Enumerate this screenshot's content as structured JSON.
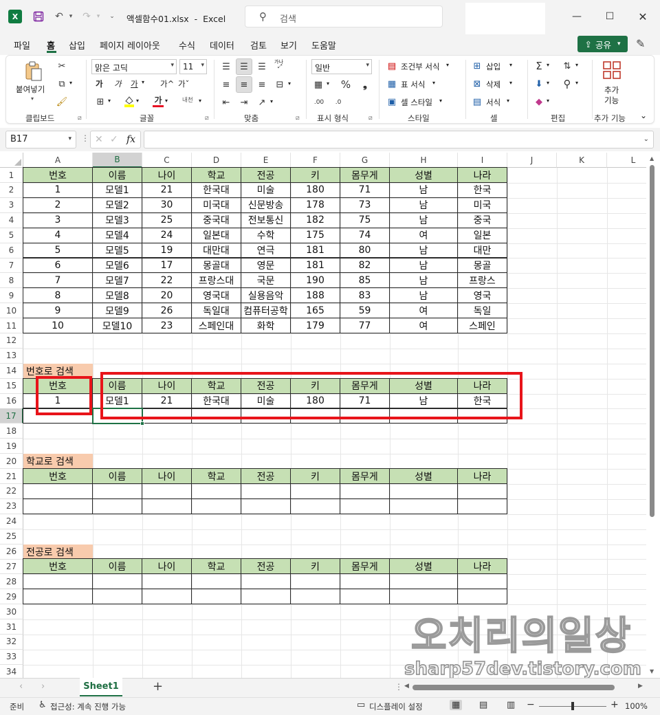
{
  "titlebar": {
    "file_name": "액셀함수01.xlsx",
    "separator": "-",
    "app_name": "Excel",
    "search_placeholder": "검색"
  },
  "menu": {
    "tabs": [
      "파일",
      "홈",
      "삽입",
      "페이지 레이아웃",
      "수식",
      "데이터",
      "검토",
      "보기",
      "도움말"
    ],
    "active": "홈",
    "share_label": "공유"
  },
  "ribbon": {
    "clipboard": {
      "paste": "붙여넣기",
      "group": "클립보드"
    },
    "font": {
      "font_name": "맑은 고딕",
      "font_size": "11",
      "bold": "가",
      "italic": "가",
      "underline": "가",
      "grow": "가^",
      "shrink": "가ˇ",
      "font_color_glyph": "가",
      "phonetic": "내천",
      "group": "글꼴",
      "fill_color": "#ffff00",
      "font_color": "#e81123"
    },
    "align": {
      "wrap": "가나",
      "group": "맞춤"
    },
    "number": {
      "format": "일반",
      "group": "표시 형식"
    },
    "styles": {
      "conditional": "조건부 서식",
      "table": "표 서식",
      "cell_style": "셀 스타일",
      "group": "스타일"
    },
    "cells": {
      "insert": "삽입",
      "delete": "삭제",
      "format": "서식",
      "group": "셀"
    },
    "editing": {
      "group": "편집"
    },
    "addins": {
      "label_line1": "추가",
      "label_line2": "기능",
      "group": "추가 기능"
    }
  },
  "formula_bar": {
    "name_box": "B17",
    "fx": "fx",
    "formula": ""
  },
  "grid": {
    "columns": [
      "A",
      "B",
      "C",
      "D",
      "E",
      "F",
      "G",
      "H",
      "I",
      "J",
      "K",
      "L"
    ],
    "selected_column": "B",
    "rows": [
      1,
      2,
      3,
      4,
      5,
      6,
      7,
      8,
      9,
      10,
      11,
      12,
      13,
      14,
      15,
      16,
      17,
      18,
      19,
      20,
      21,
      22,
      23,
      24,
      25,
      26,
      27,
      28,
      29,
      30,
      31,
      32,
      33,
      34
    ],
    "selected_row": 17,
    "header_row": [
      "번호",
      "이름",
      "나이",
      "학교",
      "전공",
      "키",
      "몸무게",
      "성별",
      "나라"
    ],
    "data": [
      [
        "1",
        "모델1",
        "21",
        "한국대",
        "미술",
        "180",
        "71",
        "남",
        "한국"
      ],
      [
        "2",
        "모델2",
        "30",
        "미국대",
        "신문방송",
        "178",
        "73",
        "남",
        "미국"
      ],
      [
        "3",
        "모델3",
        "25",
        "중국대",
        "전보통신",
        "182",
        "75",
        "남",
        "중국"
      ],
      [
        "4",
        "모델4",
        "24",
        "일본대",
        "수학",
        "175",
        "74",
        "여",
        "일본"
      ],
      [
        "5",
        "모델5",
        "19",
        "대만대",
        "연극",
        "181",
        "80",
        "남",
        "대만"
      ],
      [
        "6",
        "모델6",
        "17",
        "몽골대",
        "영문",
        "181",
        "82",
        "남",
        "몽골"
      ],
      [
        "7",
        "모델7",
        "22",
        "프랑스대",
        "국문",
        "190",
        "85",
        "남",
        "프랑스"
      ],
      [
        "8",
        "모델8",
        "20",
        "영국대",
        "실용음악",
        "188",
        "83",
        "남",
        "영국"
      ],
      [
        "9",
        "모델9",
        "26",
        "독일대",
        "컴퓨터공학",
        "165",
        "59",
        "여",
        "독일"
      ],
      [
        "10",
        "모델10",
        "23",
        "스페인대",
        "화학",
        "179",
        "77",
        "여",
        "스페인"
      ]
    ],
    "search1": {
      "label": "번호로 검색",
      "result": [
        "1",
        "모델1",
        "21",
        "한국대",
        "미술",
        "180",
        "71",
        "남",
        "한국"
      ]
    },
    "search2": {
      "label": "학교로 검색"
    },
    "search3": {
      "label": "전공로 검색"
    },
    "header_color": "#c6e0b4",
    "label_color": "#f8cbad",
    "highlight_color": "#e8141a"
  },
  "watermark": {
    "line1": "오치리의일상",
    "line2": "sharp57dev.tistory.com"
  },
  "sheets": {
    "tabs": [
      "Sheet1"
    ],
    "active": "Sheet1"
  },
  "status": {
    "ready": "준비",
    "accessibility": "접근성: 계속 진행 가능",
    "display_settings": "디스플레이 설정",
    "zoom": "100%"
  }
}
